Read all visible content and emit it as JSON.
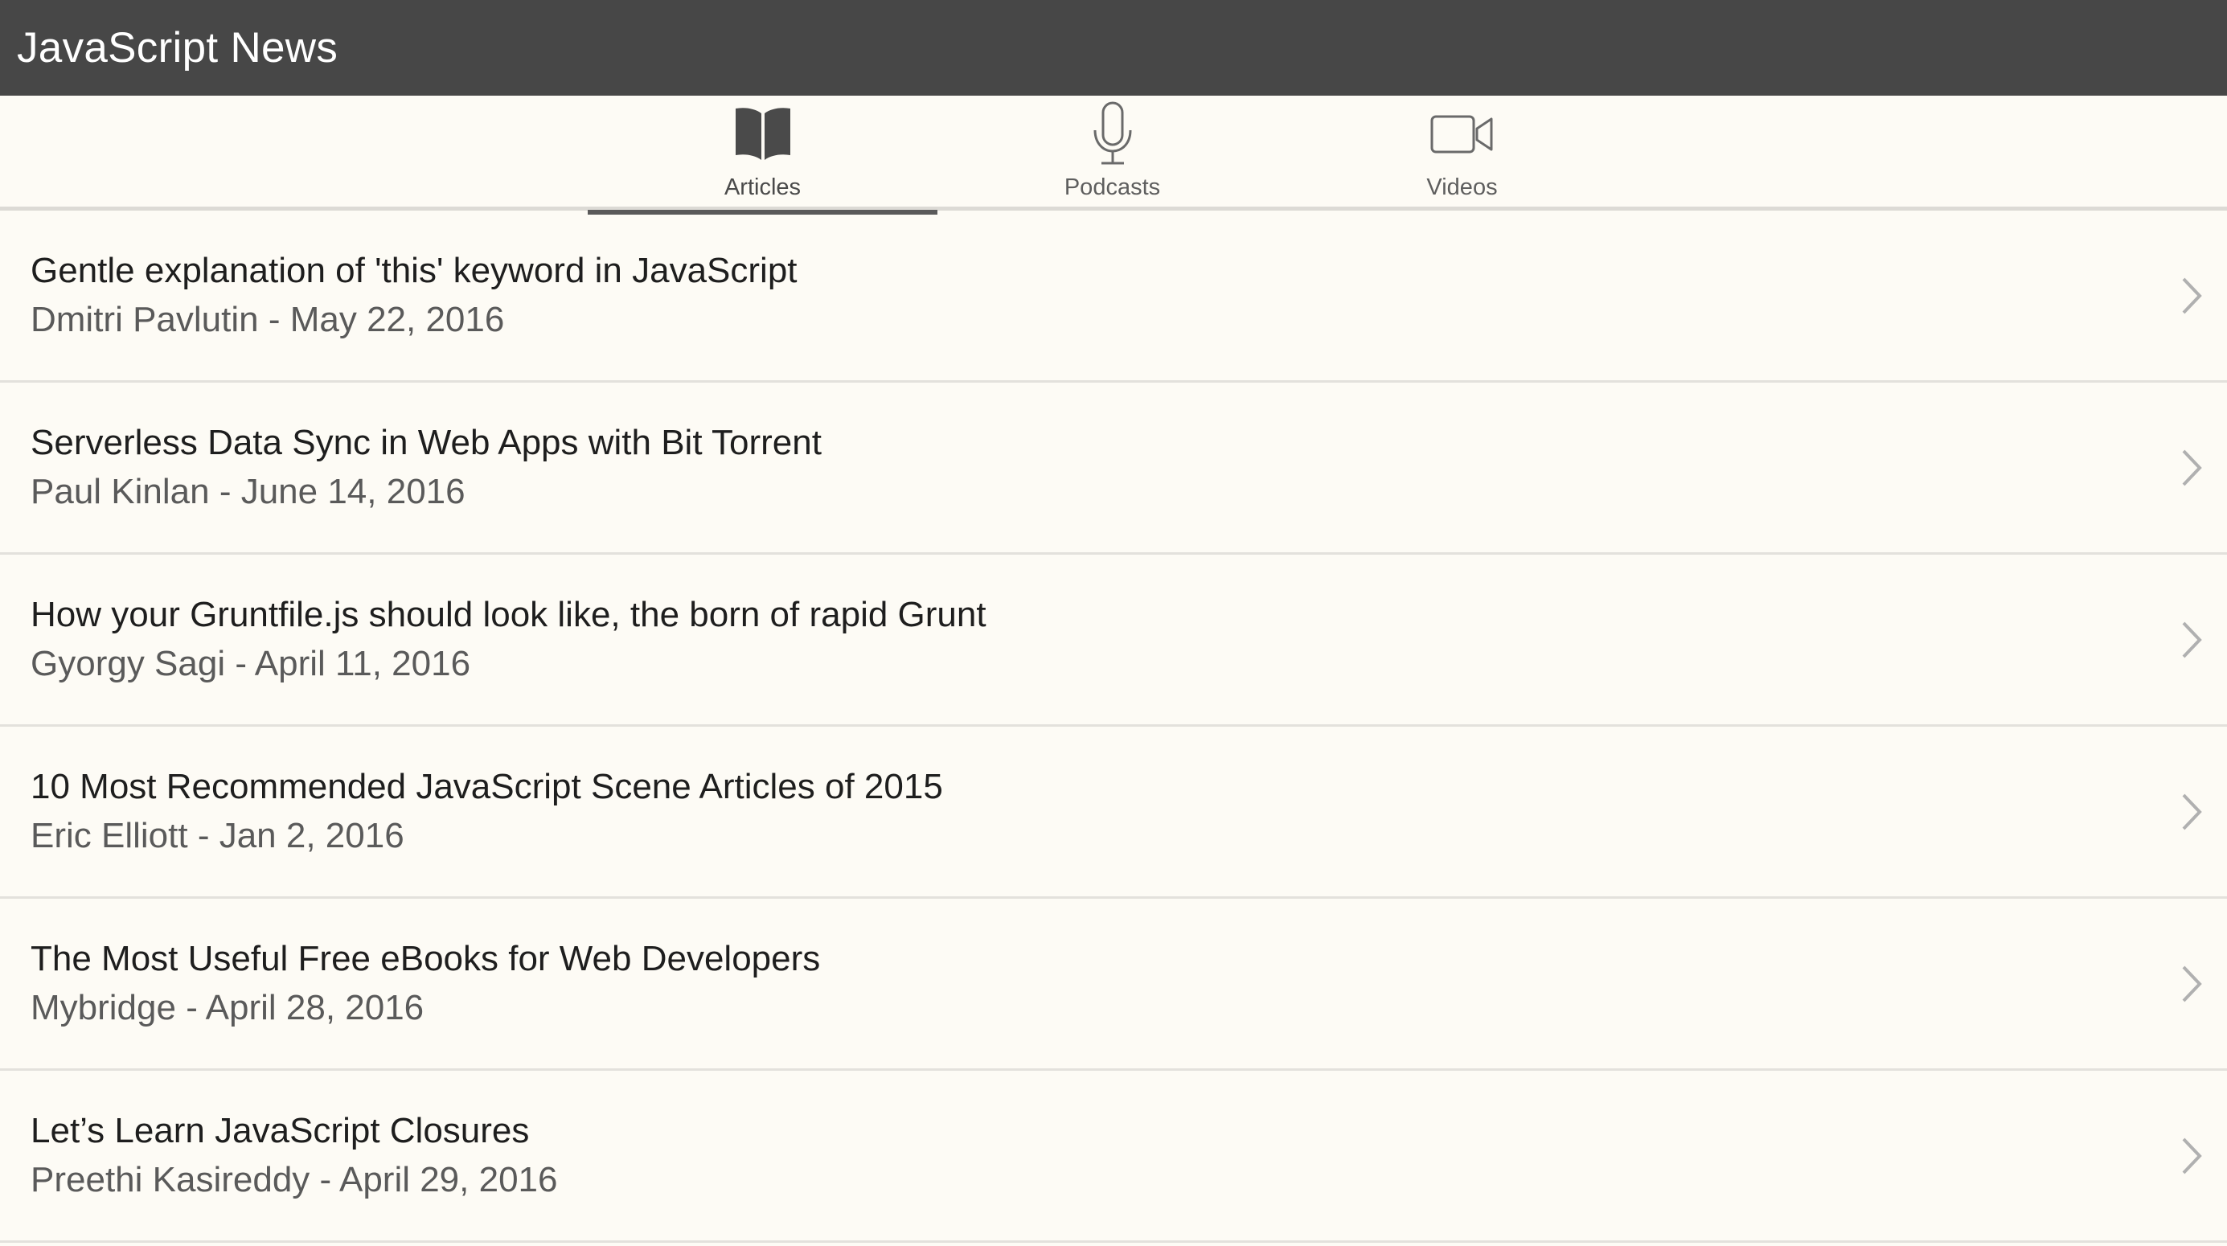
{
  "app": {
    "title": "JavaScript News"
  },
  "tabs": [
    {
      "label": "Articles",
      "icon": "book-icon",
      "active": true
    },
    {
      "label": "Podcasts",
      "icon": "microphone-icon",
      "active": false
    },
    {
      "label": "Videos",
      "icon": "video-camera-icon",
      "active": false
    }
  ],
  "articles": [
    {
      "title": "Gentle explanation of 'this' keyword in JavaScript",
      "meta": "Dmitri Pavlutin - May 22, 2016"
    },
    {
      "title": "Serverless Data Sync in Web Apps with Bit Torrent",
      "meta": "Paul Kinlan - June 14, 2016"
    },
    {
      "title": "How your Gruntfile.js should look like, the born of rapid Grunt",
      "meta": "Gyorgy Sagi - April 11, 2016"
    },
    {
      "title": "10 Most Recommended JavaScript Scene Articles of 2015",
      "meta": "Eric Elliott - Jan 2, 2016"
    },
    {
      "title": "The Most Useful Free eBooks for Web Developers",
      "meta": "Mybridge - April 28, 2016"
    },
    {
      "title": "Let’s Learn JavaScript Closures",
      "meta": "Preethi Kasireddy - April 29, 2016"
    }
  ],
  "colors": {
    "title_bar": "#474747",
    "background": "#fdfbf5",
    "active_tab_indicator": "#5a5a5a"
  }
}
